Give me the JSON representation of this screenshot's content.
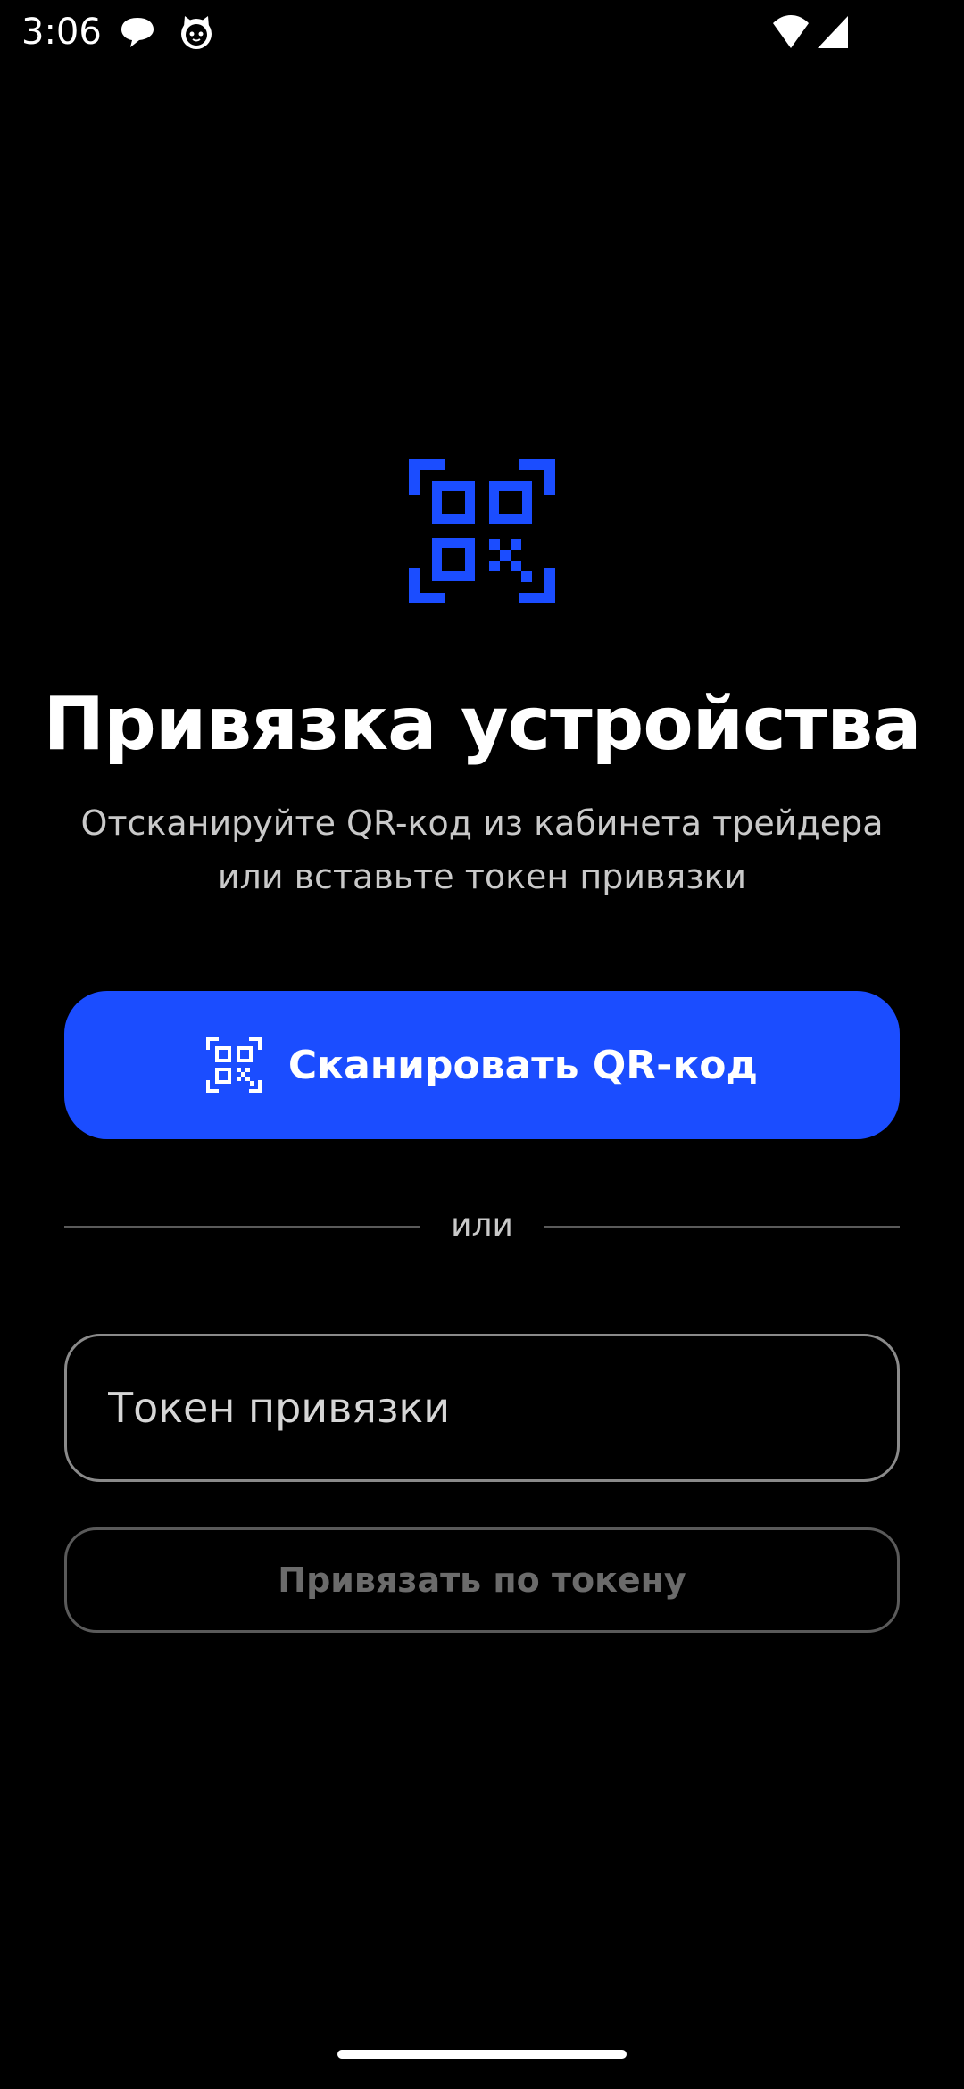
{
  "status_bar": {
    "time": "3:06",
    "left_icons": [
      "chat-bubble-icon",
      "cat-face-icon"
    ],
    "right_icons": [
      "wifi-icon",
      "cellular-signal-icon"
    ]
  },
  "hero": {
    "icon": "qr-code-scan-icon"
  },
  "title": "Привязка устройства",
  "subtitle": {
    "line1": "Отсканируйте QR-код из кабинета трейдера",
    "line2": "или вставьте токен привязки"
  },
  "scan_button": {
    "icon": "qr-code-scan-icon",
    "label": "Сканировать QR-код"
  },
  "divider": {
    "text": "или"
  },
  "token_input": {
    "value": "",
    "placeholder": "Токен привязки"
  },
  "bind_button": {
    "label": "Привязать по токену",
    "enabled": false
  },
  "colors": {
    "background": "#000000",
    "accent": "#1b4dff",
    "text_primary": "#ffffff",
    "text_secondary": "#c9c9c9",
    "disabled": "#6b6b6b"
  }
}
